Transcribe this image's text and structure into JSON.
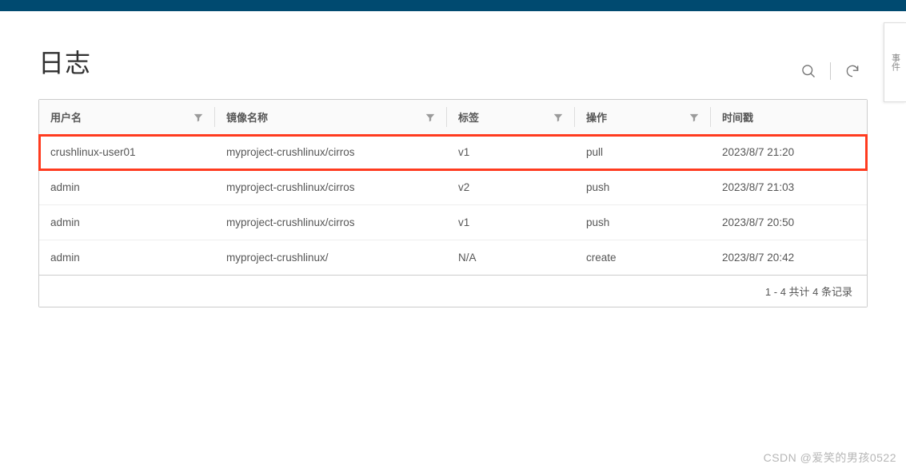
{
  "page": {
    "title": "日志"
  },
  "table": {
    "headers": {
      "user": "用户名",
      "image": "镜像名称",
      "tag": "标签",
      "operation": "操作",
      "timestamp": "时间戳"
    },
    "rows": [
      {
        "user": "crushlinux-user01",
        "image": "myproject-crushlinux/cirros",
        "tag": "v1",
        "operation": "pull",
        "timestamp": "2023/8/7 21:20",
        "highlighted": true
      },
      {
        "user": "admin",
        "image": "myproject-crushlinux/cirros",
        "tag": "v2",
        "operation": "push",
        "timestamp": "2023/8/7 21:03",
        "highlighted": false
      },
      {
        "user": "admin",
        "image": "myproject-crushlinux/cirros",
        "tag": "v1",
        "operation": "push",
        "timestamp": "2023/8/7 20:50",
        "highlighted": false
      },
      {
        "user": "admin",
        "image": "myproject-crushlinux/",
        "tag": "N/A",
        "operation": "create",
        "timestamp": "2023/8/7 20:42",
        "highlighted": false
      }
    ],
    "footer": "1 - 4 共计 4 条记录"
  },
  "sideTab": "事件",
  "watermark": "CSDN @爱笑的男孩0522"
}
